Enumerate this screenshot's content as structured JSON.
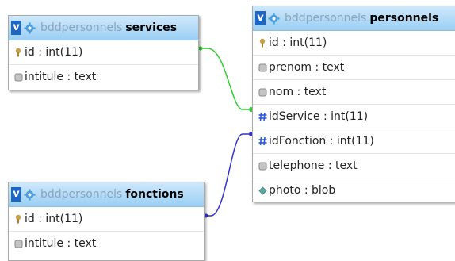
{
  "colors": {
    "link_services": "#33cc33",
    "link_fonctions": "#3333cc",
    "header_top": "#cfe8fb",
    "header_bottom": "#9bcff3",
    "v_button": "#1f66c3",
    "db_text": "#8aa4bd"
  },
  "tables": {
    "services": {
      "db": "bddpersonnels",
      "name": "services",
      "toggle": "v",
      "columns": [
        {
          "label": "id : int(11)",
          "icon": "key-icon"
        },
        {
          "label": "intitule : text",
          "icon": "column-icon"
        }
      ]
    },
    "personnels": {
      "db": "bddpersonnels",
      "name": "personnels",
      "toggle": "v",
      "columns": [
        {
          "label": "id : int(11)",
          "icon": "key-icon"
        },
        {
          "label": "prenom : text",
          "icon": "column-icon"
        },
        {
          "label": "nom : text",
          "icon": "column-icon"
        },
        {
          "label": "idService : int(11)",
          "icon": "foreign-key-icon"
        },
        {
          "label": "idFonction : int(11)",
          "icon": "foreign-key-icon"
        },
        {
          "label": "telephone : text",
          "icon": "column-icon"
        },
        {
          "label": "photo : blob",
          "icon": "blob-icon"
        }
      ]
    },
    "fonctions": {
      "db": "bddpersonnels",
      "name": "fonctions",
      "toggle": "v",
      "columns": [
        {
          "label": "id : int(11)",
          "icon": "key-icon"
        },
        {
          "label": "intitule : text",
          "icon": "column-icon"
        }
      ]
    }
  }
}
